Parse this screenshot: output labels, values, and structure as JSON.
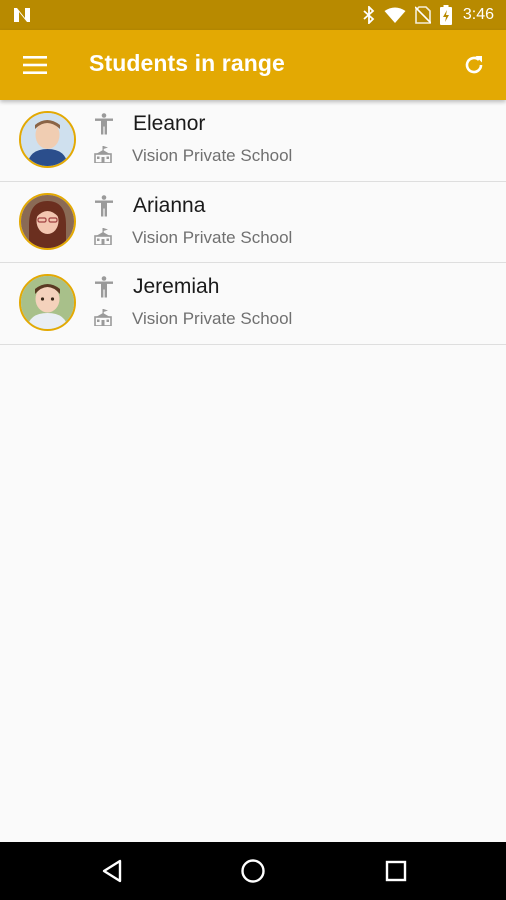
{
  "status_bar": {
    "time": "3:46",
    "icons": [
      "n-notification-icon",
      "bluetooth-icon",
      "wifi-icon",
      "no-sim-icon",
      "battery-charging-icon"
    ]
  },
  "app_bar": {
    "title": "Students in range",
    "menu_icon": "hamburger-menu-icon",
    "refresh_icon": "refresh-icon"
  },
  "students": [
    {
      "name": "Eleanor",
      "school": "Vision Private School",
      "avatar_bg": "#cfe0ee"
    },
    {
      "name": "Arianna",
      "school": "Vision Private School",
      "avatar_bg": "#8a6a55"
    },
    {
      "name": "Jeremiah",
      "school": "Vision Private School",
      "avatar_bg": "#a8c08a"
    }
  ],
  "nav_bar": {
    "icons": [
      "back-triangle-icon",
      "home-circle-icon",
      "recents-square-icon"
    ]
  },
  "colors": {
    "status_bar": "#b88a00",
    "app_bar": "#e3a903",
    "avatar_border": "#e3a903",
    "background": "#fafafa"
  }
}
